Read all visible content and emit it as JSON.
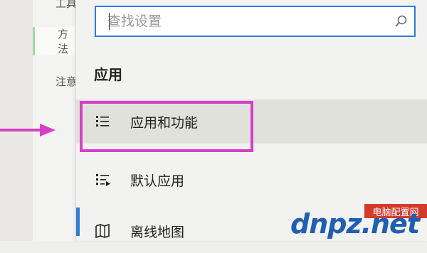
{
  "background": {
    "items": [
      "工具",
      "方法",
      "注意"
    ]
  },
  "search": {
    "placeholder": "查找设置"
  },
  "section": {
    "title": "应用"
  },
  "nav": {
    "items": [
      {
        "label": "应用和功能",
        "icon": "apps-features-icon"
      },
      {
        "label": "默认应用",
        "icon": "default-apps-icon"
      },
      {
        "label": "离线地图",
        "icon": "offline-maps-icon"
      }
    ]
  },
  "colors": {
    "accent": "#2f7dd6",
    "highlight": "#d63fc8",
    "arrow": "#d63fc8"
  },
  "watermark": {
    "site_text": "dnpz.net",
    "brand_text": "电脑配置网"
  }
}
